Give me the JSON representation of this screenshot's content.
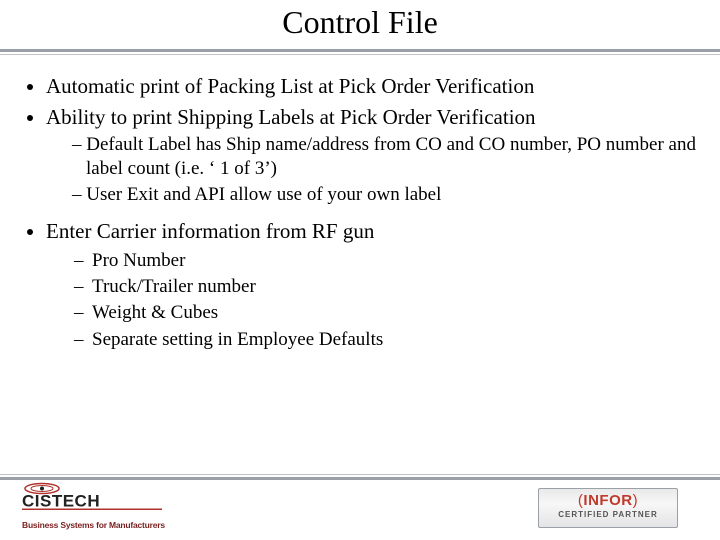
{
  "title": "Control File",
  "bullets": {
    "b1": "Automatic print of Packing List at Pick Order Verification",
    "b2": "Ability to print Shipping Labels at Pick Order Verification",
    "b2_sub": {
      "s1": "Default Label has Ship name/address from CO and CO number, PO number and label count (i.e. ‘ 1 of 3’)",
      "s2": "User Exit and API allow use of your own label"
    },
    "b3": "Enter Carrier information from RF gun",
    "b3_sub": {
      "s1": "Pro Number",
      "s2": "Truck/Trailer number",
      "s3": "Weight & Cubes",
      "s4": "Separate setting in Employee Defaults"
    }
  },
  "logos": {
    "left_name": "CISTECH",
    "left_tag": "Business Systems for Manufacturers",
    "right_brand_open": "(",
    "right_brand_text": "INFOR",
    "right_brand_close": ")",
    "right_sub": "CERTIFIED PARTNER"
  }
}
